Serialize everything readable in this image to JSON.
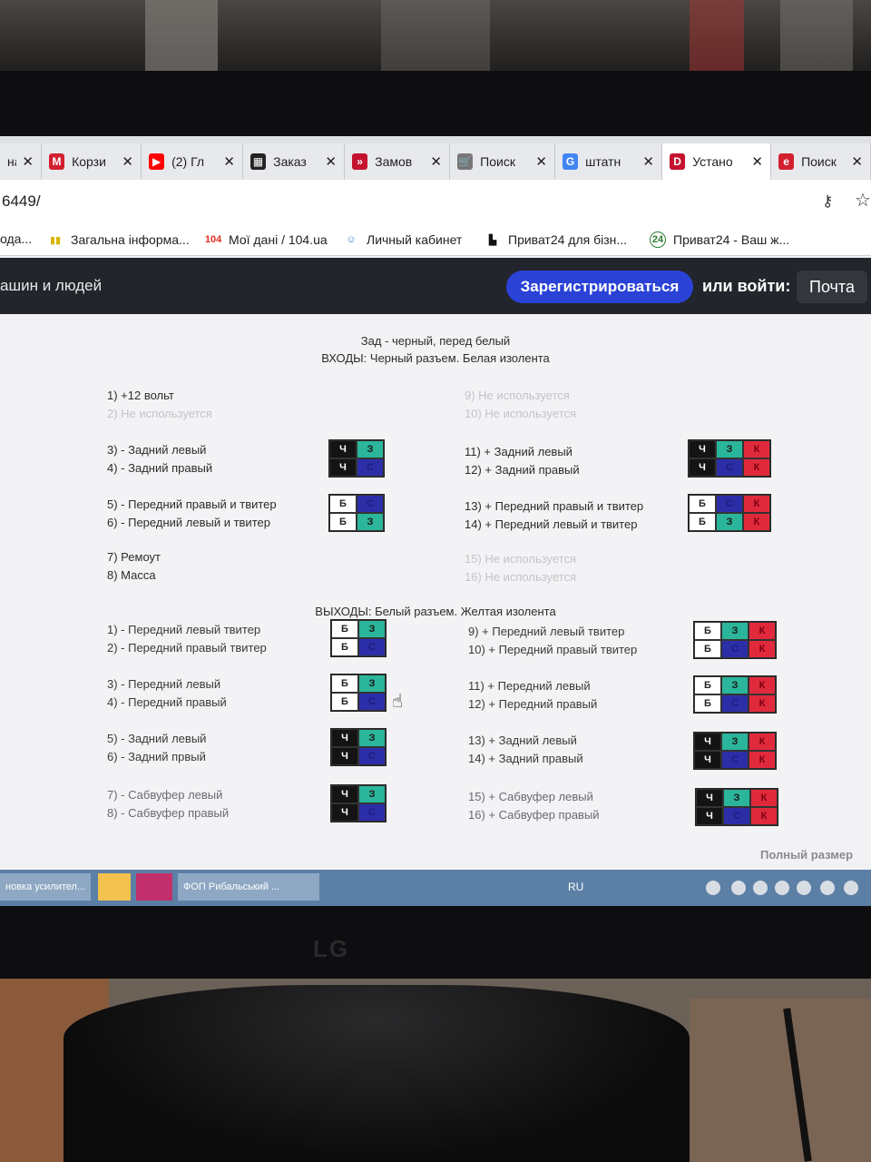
{
  "browser": {
    "tabs": [
      {
        "label": "на",
        "icon_color": "#cccccc",
        "icon_glyph": ""
      },
      {
        "label": "Корзи",
        "icon_color": "#d32030",
        "icon_glyph": "M"
      },
      {
        "label": "(2) Гл",
        "icon_color": "#ff0000",
        "icon_glyph": "▶"
      },
      {
        "label": "Заказ",
        "icon_color": "#222222",
        "icon_glyph": "▦"
      },
      {
        "label": "Замов",
        "icon_color": "#c4122f",
        "icon_glyph": "»"
      },
      {
        "label": "Поиск",
        "icon_color": "#777777",
        "icon_glyph": "🛒"
      },
      {
        "label": "штатн",
        "icon_color": "#4285f4",
        "icon_glyph": "G"
      },
      {
        "label": "Устано",
        "icon_color": "#c4122f",
        "icon_glyph": "D"
      },
      {
        "label": "Поиск",
        "icon_color": "#d32030",
        "icon_glyph": "e"
      }
    ],
    "active_tab": 7,
    "tab_close_glyph": "✕",
    "url": "6449/",
    "bookmarks": [
      {
        "label": "ода...",
        "icon": ""
      },
      {
        "label": "Загальна інформа...",
        "icon": "▮▮"
      },
      {
        "label": "Мої дані / 104.ua",
        "icon": "104"
      },
      {
        "label": "Личный кабинет",
        "icon": "☺"
      },
      {
        "label": "Приват24 для бізн...",
        "icon": "▙"
      },
      {
        "label": "Приват24 - Ваш ж...",
        "icon": "24"
      }
    ]
  },
  "site_header": {
    "tagline": "ашин и людей",
    "register_label": "Зарегистрироваться",
    "login_text": "или войти:",
    "mail_label": "Почта"
  },
  "content": {
    "heading_line1": "Зад - черный, перед белый",
    "heading_line2": "ВХОДЫ: Черный разъем. Белая изолента",
    "outputs_heading": "ВЫХОДЫ: Белый разъем. Желтая изолента",
    "full_size": "Полный размер",
    "inputs_left": [
      {
        "text": "1) +12 вольт",
        "faint": false
      },
      {
        "text": "2) Не используется",
        "faint": true
      },
      {
        "text": "3) - Задний левый",
        "faint": false
      },
      {
        "text": "4) - Задний правый",
        "faint": false
      },
      {
        "text": "5) - Передний правый и твитер",
        "faint": false
      },
      {
        "text": "6) - Передний левый и твитер",
        "faint": false
      },
      {
        "text": "7) Ремоут",
        "faint": false
      },
      {
        "text": "8) Масса",
        "faint": false
      }
    ],
    "inputs_right": [
      {
        "text": "9) Не используется",
        "faint": true
      },
      {
        "text": "10) Не используется",
        "faint": true
      },
      {
        "text": "11) + Задний левый",
        "faint": false
      },
      {
        "text": "12) + Задний правый",
        "faint": false
      },
      {
        "text": "13) + Передний правый и твитер",
        "faint": false
      },
      {
        "text": "14) + Передний левый и твитер",
        "faint": false
      },
      {
        "text": "15) Не используется",
        "faint": true
      },
      {
        "text": "16) Не используется",
        "faint": true
      }
    ],
    "outputs_left": [
      "1) - Передний левый твитер",
      "2) - Передний правый твитер",
      "3) - Передний левый",
      "4) - Передний правый",
      "5) - Задний левый",
      "6) - Задний првый",
      "7) - Сабвуфер левый",
      "8) - Сабвуфер правый"
    ],
    "outputs_right": [
      "9) + Передний левый твитер",
      "10) + Передний правый твитер",
      "11) + Передний левый",
      "12) + Передний правый",
      "13) + Задний левый",
      "14) + Задний правый",
      "15) + Сабвуфер левый",
      "16) + Сабвуфер правый"
    ],
    "connectors": [
      {
        "rows": [
          [
            "Ч",
            "black"
          ],
          [
            "Ч",
            "black"
          ]
        ],
        "cols2": [
          [
            "З",
            "green"
          ],
          [
            "С",
            "blue"
          ]
        ]
      },
      {
        "rows": [
          [
            "Ч",
            "black"
          ],
          [
            "Ч",
            "black"
          ]
        ],
        "cols2": [
          [
            "З",
            "green"
          ],
          [
            "С",
            "blue"
          ]
        ],
        "cols3": [
          [
            "К",
            "red"
          ],
          [
            "К",
            "red"
          ]
        ]
      },
      {
        "rows": [
          [
            "Б",
            "white"
          ],
          [
            "Б",
            "white"
          ]
        ],
        "cols2": [
          [
            "С",
            "blue"
          ],
          [
            "З",
            "green"
          ]
        ]
      },
      {
        "rows": [
          [
            "Б",
            "white"
          ],
          [
            "Б",
            "white"
          ]
        ],
        "cols2": [
          [
            "С",
            "blue"
          ],
          [
            "З",
            "green"
          ]
        ],
        "cols3": [
          [
            "К",
            "red"
          ],
          [
            "К",
            "red"
          ]
        ]
      },
      {
        "rows": [
          [
            "Б",
            "white"
          ],
          [
            "Б",
            "white"
          ]
        ],
        "cols2": [
          [
            "З",
            "green"
          ],
          [
            "С",
            "blue"
          ]
        ]
      },
      {
        "rows": [
          [
            "Б",
            "white"
          ],
          [
            "Б",
            "white"
          ]
        ],
        "cols2": [
          [
            "З",
            "green"
          ],
          [
            "С",
            "blue"
          ]
        ],
        "cols3": [
          [
            "К",
            "red"
          ],
          [
            "К",
            "red"
          ]
        ]
      },
      {
        "rows": [
          [
            "Б",
            "white"
          ],
          [
            "Б",
            "white"
          ]
        ],
        "cols2": [
          [
            "З",
            "green"
          ],
          [
            "С",
            "blue"
          ]
        ]
      },
      {
        "rows": [
          [
            "Б",
            "white"
          ],
          [
            "Б",
            "white"
          ]
        ],
        "cols2": [
          [
            "З",
            "green"
          ],
          [
            "С",
            "blue"
          ]
        ],
        "cols3": [
          [
            "К",
            "red"
          ],
          [
            "К",
            "red"
          ]
        ]
      },
      {
        "rows": [
          [
            "Ч",
            "black"
          ],
          [
            "Ч",
            "black"
          ]
        ],
        "cols2": [
          [
            "З",
            "green"
          ],
          [
            "С",
            "blue"
          ]
        ]
      },
      {
        "rows": [
          [
            "Ч",
            "black"
          ],
          [
            "Ч",
            "black"
          ]
        ],
        "cols2": [
          [
            "З",
            "green"
          ],
          [
            "С",
            "blue"
          ]
        ],
        "cols3": [
          [
            "К",
            "red"
          ],
          [
            "К",
            "red"
          ]
        ]
      },
      {
        "rows": [
          [
            "Ч",
            "black"
          ],
          [
            "Ч",
            "black"
          ]
        ],
        "cols2": [
          [
            "З",
            "green"
          ],
          [
            "С",
            "blue"
          ]
        ]
      },
      {
        "rows": [
          [
            "Ч",
            "black"
          ],
          [
            "Ч",
            "black"
          ]
        ],
        "cols2": [
          [
            "З",
            "green"
          ],
          [
            "С",
            "blue"
          ]
        ],
        "cols3": [
          [
            "К",
            "red"
          ],
          [
            "К",
            "red"
          ]
        ]
      }
    ]
  },
  "taskbar": {
    "items": [
      "новка усилител...",
      "",
      "",
      "ФОП Рибальський ..."
    ],
    "language": "RU"
  },
  "monitor": {
    "brand": "LG"
  }
}
